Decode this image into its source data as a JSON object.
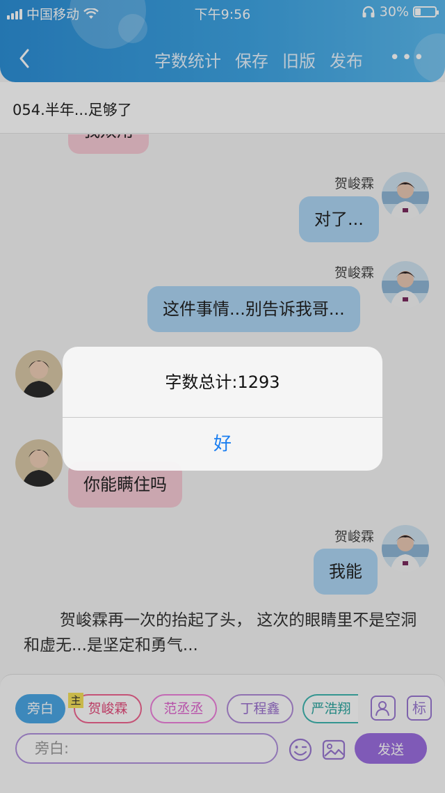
{
  "status_bar": {
    "carrier": "中国移动",
    "time": "下午9:56",
    "battery": "30%",
    "battery_level": 0.3
  },
  "nav": {
    "actions": [
      "字数统计",
      "保存",
      "旧版",
      "发布"
    ],
    "more": "•••"
  },
  "chapter": {
    "title": "054.半年...足够了"
  },
  "messages": {
    "partial_left": "我双用",
    "right_1": {
      "speaker": "贺峻霖",
      "text": "对了..."
    },
    "right_2": {
      "speaker": "贺峻霖",
      "text": "这件事情...别告诉我哥..."
    },
    "left_2": {
      "text": "你能瞒住吗"
    },
    "right_3": {
      "speaker": "贺峻霖",
      "text": "我能"
    },
    "narration": "贺峻霖再一次的抬起了头， 这次的眼睛里不是空洞和虚无...是坚定和勇气..."
  },
  "panel": {
    "narration_chip": "旁白",
    "main_tag": "主",
    "characters": [
      "贺峻霖",
      "范丞丞",
      "丁程鑫",
      "严浩翔"
    ],
    "role_icon": "user-card-icon",
    "tag_button": "标",
    "input_placeholder": "旁白:",
    "send": "发送"
  },
  "alert": {
    "message": "字数总计:1293",
    "button": "好"
  },
  "colors": {
    "header": "#3ea4e3",
    "bubble_right": "#aed6f5",
    "bubble_left": "#f7cbd6",
    "send": "#9c6ee0",
    "alert_button": "#1a7ef0"
  }
}
